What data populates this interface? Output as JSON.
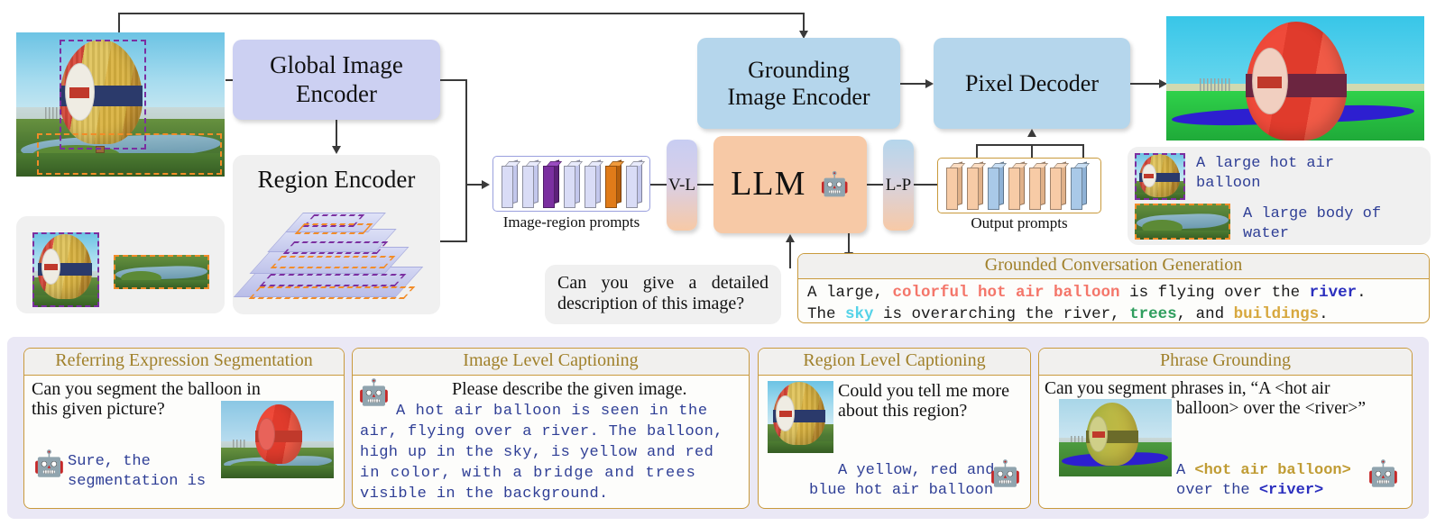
{
  "figure": {
    "type": "architecture-diagram",
    "title": "GLaMM multimodal grounding architecture"
  },
  "modules": {
    "global_image_encoder": "Global Image\nEncoder",
    "global_image_encoder_line1": "Global Image",
    "global_image_encoder_line2": "Encoder",
    "region_encoder": "Region Encoder",
    "grounding_image_encoder_line1": "Grounding",
    "grounding_image_encoder_line2": "Image Encoder",
    "pixel_decoder": "Pixel Decoder",
    "llm": "LLM",
    "vl_projector": "V-L",
    "lp_projector": "L-P"
  },
  "prompts": {
    "image_region_label": "Image-region prompts",
    "output_label": "Output prompts",
    "image_region_tokens": [
      "lavender",
      "lavender",
      "purple",
      "lavender",
      "lavender",
      "orange",
      "lavender"
    ],
    "output_tokens": [
      "peach",
      "peach",
      "blue",
      "peach",
      "peach",
      "peach",
      "blue"
    ]
  },
  "user_question": {
    "line1": "Can you give a detailed",
    "line2": "description of this image?"
  },
  "region_captions": [
    {
      "box_color": "purple",
      "line1": "A large hot air",
      "line2": "balloon"
    },
    {
      "box_color": "orange",
      "line1": "A large body of",
      "line2": "water"
    }
  ],
  "gcg": {
    "title": "Grounded Conversation Generation",
    "line1_segments": [
      {
        "text": "A large, ",
        "color": "#1a1a1a",
        "bold": false
      },
      {
        "text": "colorful hot air balloon",
        "color": "#f4766a",
        "bold": true
      },
      {
        "text": " is flying over the ",
        "color": "#1a1a1a",
        "bold": false
      },
      {
        "text": "river",
        "color": "#2b2fbe",
        "bold": true
      },
      {
        "text": ".",
        "color": "#1a1a1a",
        "bold": false
      }
    ],
    "line2_segments": [
      {
        "text": "The ",
        "color": "#1a1a1a",
        "bold": false
      },
      {
        "text": "sky",
        "color": "#56d3e8",
        "bold": true
      },
      {
        "text": " is overarching the river, ",
        "color": "#1a1a1a",
        "bold": false
      },
      {
        "text": "trees",
        "color": "#2f9e5e",
        "bold": true
      },
      {
        "text": ", and ",
        "color": "#1a1a1a",
        "bold": false
      },
      {
        "text": "buildings",
        "color": "#d7a83f",
        "bold": true
      },
      {
        "text": ".",
        "color": "#1a1a1a",
        "bold": false
      }
    ]
  },
  "tasks": [
    {
      "id": "referring-expression-segmentation",
      "title": "Referring Expression Segmentation",
      "question_line1": "Can you segment the balloon in",
      "question_line2": "this given picture?",
      "answer_line1": "Sure, the",
      "answer_line2": "segmentation is"
    },
    {
      "id": "image-level-captioning",
      "title": "Image Level Captioning",
      "question": "Please describe the given image.",
      "answer_line1": "A hot air balloon is seen in the",
      "answer_line2": "air, flying over a river. The balloon,",
      "answer_line3": "high up in the sky, is yellow and red",
      "answer_line4": "in color, with a bridge and trees",
      "answer_line5": "visible in the background."
    },
    {
      "id": "region-level-captioning",
      "title": "Region Level Captioning",
      "question_line1": "Could you tell me more",
      "question_line2": "about this region?",
      "answer_line1": "A yellow, red and",
      "answer_line2": "blue hot air balloon"
    },
    {
      "id": "phrase-grounding",
      "title": "Phrase Grounding",
      "question_line1": "Can you segment phrases in, “A <hot air",
      "question_line2": "balloon> over the <river>”",
      "answer_line1_segments": [
        {
          "text": "A ",
          "color": "#2f3f96",
          "bold": false
        },
        {
          "text": "<hot air balloon>",
          "color": "#c09c34",
          "bold": true
        }
      ],
      "answer_line2_segments": [
        {
          "text": "over the ",
          "color": "#2f3f96",
          "bold": false
        },
        {
          "text": "<river>",
          "color": "#2b2fbe",
          "bold": true
        }
      ]
    }
  ],
  "icons": {
    "robot": "robot-icon",
    "arrow": "arrow-icon"
  },
  "colors": {
    "lavender_box": "#ccd0f2",
    "blue_box": "#b5d6ec",
    "peach_box": "#f7c9a6",
    "gray_panel": "#f0f0f0",
    "card_border": "#c99a3c",
    "card_title": "#a0802a",
    "bottom_panel_bg": "#eae8f5",
    "purple_dash": "#7b2fa0",
    "orange_dash": "#f28c28",
    "mono_text": "#2f3f96"
  }
}
